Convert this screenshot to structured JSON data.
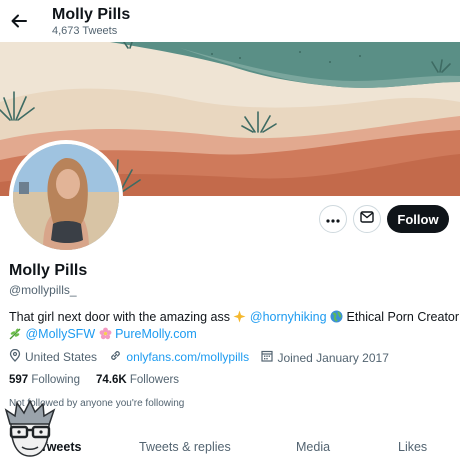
{
  "header": {
    "name": "Molly Pills",
    "tweet_count": "4,673 Tweets"
  },
  "profile": {
    "name": "Molly Pills",
    "handle": "@mollypills_",
    "follow_label": "Follow",
    "bio": {
      "line1_text1": "That girl next door with the amazing ass ",
      "line1_link1": "@hornyhiking",
      "line1_text2": " Ethical Porn Creator",
      "line2_link1": "@MollySFW",
      "line2_link2": "PureMolly.com"
    },
    "meta": {
      "location": "United States",
      "website": "onlyfans.com/mollypills",
      "joined": "Joined January 2017"
    },
    "stats": {
      "following_count": "597",
      "following_label": "Following",
      "followers_count": "74.6K",
      "followers_label": "Followers"
    },
    "followers_note": "Not followed by anyone you're following"
  },
  "tabs": [
    "Tweets",
    "Tweets & replies",
    "Media",
    "Likes"
  ],
  "colors": {
    "accent": "#1d9bf0",
    "dark": "#0f1419",
    "muted": "#536471"
  },
  "icons": [
    "back-arrow-icon",
    "more-icon",
    "message-icon",
    "location-icon",
    "link-icon",
    "calendar-icon",
    "sparkles-icon",
    "globe-icon",
    "herb-icon",
    "flower-icon"
  ]
}
